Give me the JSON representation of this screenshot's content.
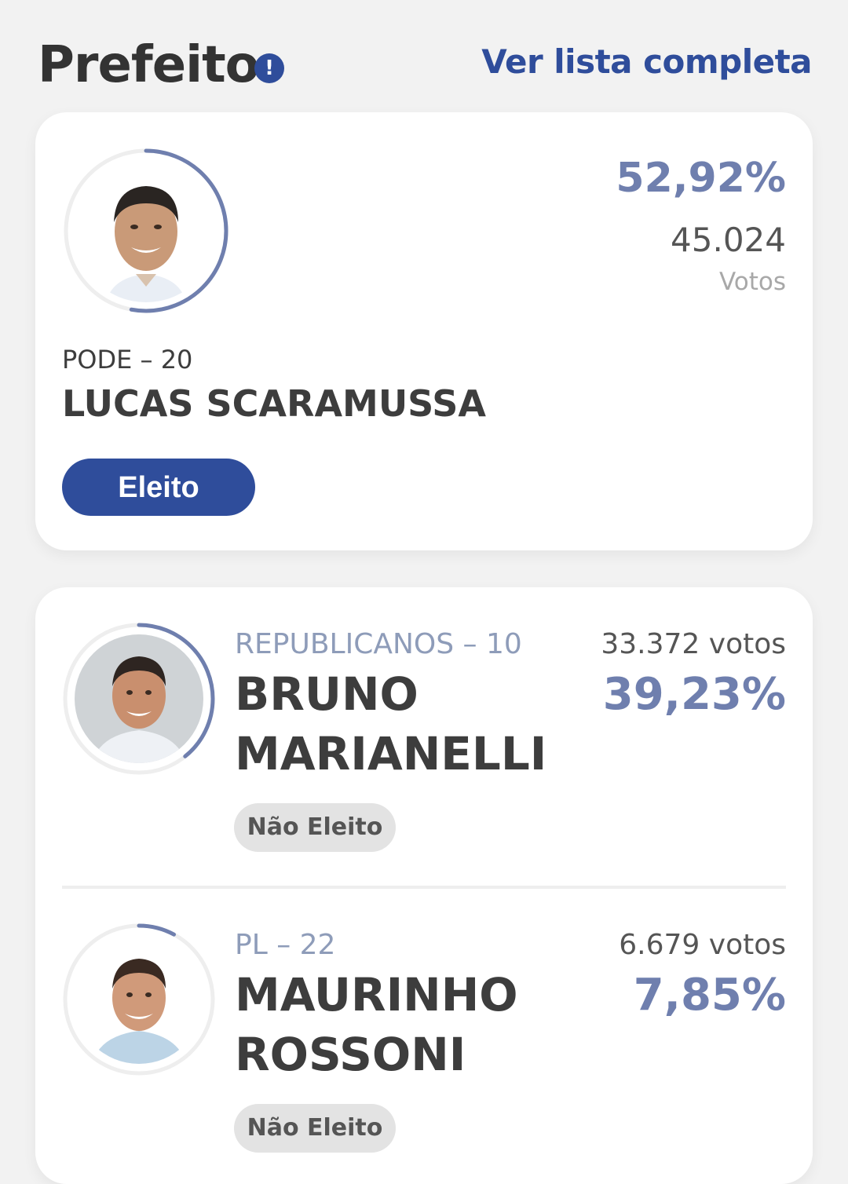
{
  "header": {
    "title": "Prefeito",
    "info_icon": "!",
    "see_all_label": "Ver lista completa"
  },
  "colors": {
    "accent": "#2f4d9b",
    "percent": "#6f7fae",
    "background": "#f2f2f2"
  },
  "winner": {
    "percent": "52,92%",
    "vote_share": 0.5292,
    "votes": "45.024",
    "votes_label": "Votos",
    "party": "PODE – 20",
    "name": "LUCAS SCARAMUSSA",
    "status": "Eleito"
  },
  "candidates": [
    {
      "party": "REPUBLICANOS – 10",
      "name_line1": "BRUNO",
      "name_line2": "MARIANELLI",
      "votes": "33.372 votos",
      "percent": "39,23%",
      "vote_share": 0.3923,
      "status": "Não Eleito"
    },
    {
      "party": "PL – 22",
      "name_line1": "MAURINHO",
      "name_line2": "ROSSONI",
      "votes": "6.679 votos",
      "percent": "7,85%",
      "vote_share": 0.0785,
      "status": "Não Eleito"
    }
  ]
}
